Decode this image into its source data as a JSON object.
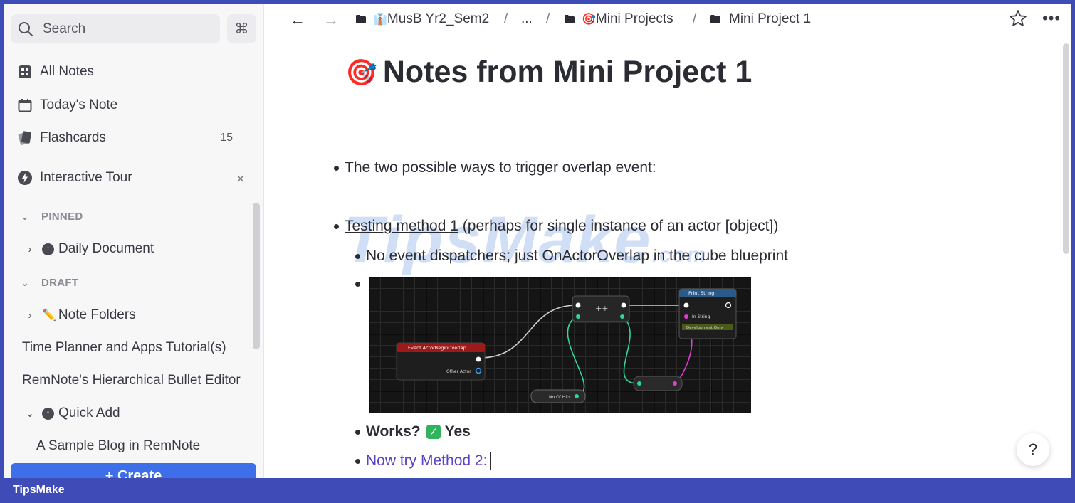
{
  "sidebar": {
    "search_placeholder": "Search",
    "cmd_key": "⌘",
    "nav": [
      {
        "label": "All Notes"
      },
      {
        "label": "Today's Note"
      },
      {
        "label": "Flashcards",
        "count": "15"
      },
      {
        "label": "Interactive Tour"
      }
    ],
    "pinned_label": "PINNED",
    "pinned_items": [
      {
        "label": "Daily Document"
      }
    ],
    "draft_label": "DRAFT",
    "draft_items": [
      {
        "label": "Note Folders",
        "emoji": "✏️"
      },
      {
        "label": "Time Planner and Apps Tutorial(s)"
      },
      {
        "label": "RemNote's Hierarchical Bullet Editor"
      },
      {
        "label": "Quick Add"
      },
      {
        "label": "A Sample Blog in RemNote"
      }
    ],
    "create_label": "+ Create"
  },
  "breadcrumb": [
    {
      "label": "MusB Yr2_Sem2",
      "emoji": "👔"
    },
    {
      "label": "..."
    },
    {
      "label": "Mini Projects",
      "emoji": "🎯"
    },
    {
      "label": "Mini Project 1"
    }
  ],
  "breadcrumb_separator": "/",
  "document": {
    "title": "Notes from Mini Project 1",
    "title_emoji": "🎯",
    "bullets": {
      "b1": "The two possible ways to trigger overlap event:",
      "b2_link": "Testing method 1",
      "b2_rest": " (perhaps for single instance of an actor [object])",
      "b3": "No event dispatchers; just OnActorOverlap in the cube blueprint",
      "b4_label": "Works?",
      "b4_check": "✓",
      "b4_value": "Yes",
      "b5": "Now try Method 2:"
    }
  },
  "blueprint": {
    "event_node": "Event ActorBeginOverlap",
    "event_pin": "Other Actor",
    "increment_node": "++",
    "print_node": "Print String",
    "print_pin": "In String",
    "dev_only": "Development Only",
    "var_node": "No Of Hits"
  },
  "help_label": "?",
  "watermark": {
    "main": "TipsMake",
    "suffix": ".com"
  },
  "footer_brand": "TipsMake",
  "colors": {
    "accent": "#3d6fe8",
    "brand_bar": "#3f4cb8",
    "link_purple": "#5a42c8",
    "check_green": "#2fb35c"
  }
}
